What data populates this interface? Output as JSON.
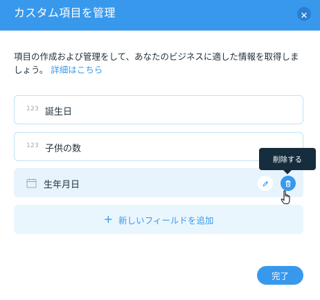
{
  "dialog": {
    "title": "カスタム項目を管理",
    "close_icon": "close-icon"
  },
  "description": {
    "text": "項目の作成および管理をして、あなたのビジネスに適した情報を取得しましょう。",
    "link": "詳細はこちら"
  },
  "fields": [
    {
      "type_label": "123",
      "label": "誕生日",
      "icon": "number-type-icon"
    },
    {
      "type_label": "123",
      "label": "子供の数",
      "icon": "number-type-icon"
    },
    {
      "label": "生年月日",
      "icon": "calendar-icon",
      "selected": true
    }
  ],
  "tooltip": {
    "text": "削除する"
  },
  "add_field": {
    "label": "新しいフィールドを追加"
  },
  "footer": {
    "done_label": "完了"
  },
  "colors": {
    "accent": "#3899ec",
    "header_bg": "#3899ec",
    "tooltip_bg": "#162d3d",
    "selected_row_bg": "#e7f4fd"
  }
}
